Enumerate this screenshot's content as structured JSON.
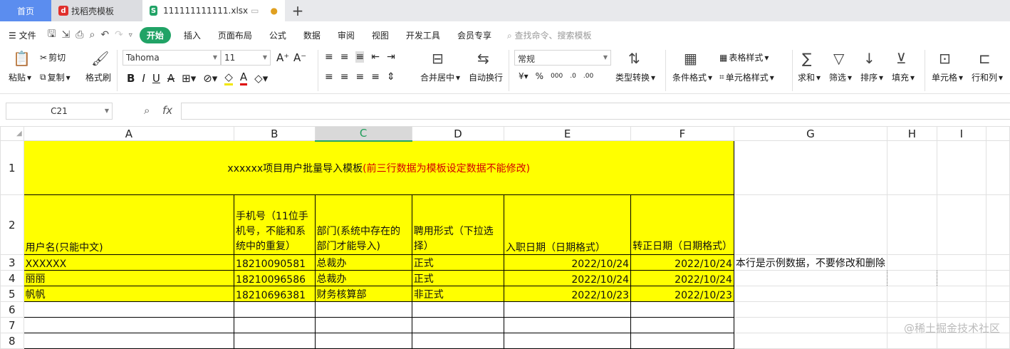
{
  "tabs": [
    {
      "label": "首页"
    },
    {
      "label": "找稻壳模板"
    },
    {
      "label": "111111111111.xlsx"
    }
  ],
  "menu": {
    "file": "文件",
    "items": [
      "开始",
      "插入",
      "页面布局",
      "公式",
      "数据",
      "审阅",
      "视图",
      "开发工具",
      "会员专享"
    ],
    "search": "查找命令、搜索模板"
  },
  "ribbon": {
    "paste": "粘贴",
    "cut": "剪切",
    "copy": "复制",
    "format_painter": "格式刷",
    "font": "Tahoma",
    "size": "11",
    "merge": "合并居中",
    "wrap": "自动换行",
    "number_format": "常规",
    "convert": "类型转换",
    "cond_format": "条件格式",
    "table_style": "表格样式",
    "cell_style": "单元格样式",
    "sum": "求和",
    "filter": "筛选",
    "sort": "排序",
    "fill": "填充",
    "cell": "单元格",
    "rowcol": "行和列"
  },
  "formula": {
    "namebox": "C21",
    "fx": "fx",
    "value": ""
  },
  "columns": [
    "A",
    "B",
    "C",
    "D",
    "E",
    "F",
    "G",
    "H",
    "I"
  ],
  "rows": [
    "1",
    "2",
    "3",
    "4",
    "5",
    "6",
    "7",
    "8"
  ],
  "title": {
    "black": "xxxxxx项目用户批量导入模板",
    "red": "(前三行数据为模板设定数据不能修改)"
  },
  "headers": [
    "用户名(只能中文)",
    "手机号（11位手机号，不能和系统中的重复）",
    "部门(系统中存在的部门才能导入)",
    "聘用形式（下拉选择）",
    "入职日期（日期格式）",
    "转正日期（日期格式）"
  ],
  "data": [
    [
      "XXXXXX",
      "18210090581",
      "总裁办",
      "正式",
      "2022/10/24",
      "2022/10/24"
    ],
    [
      "丽丽",
      "18210096586",
      "总裁办",
      "正式",
      "2022/10/24",
      "2022/10/24"
    ],
    [
      "帆帆",
      "18210696381",
      "财务核算部",
      "非正式",
      "2022/10/23",
      "2022/10/23"
    ]
  ],
  "note": "本行是示例数据，不要修改和删除",
  "watermark": "@稀土掘金技术社区"
}
